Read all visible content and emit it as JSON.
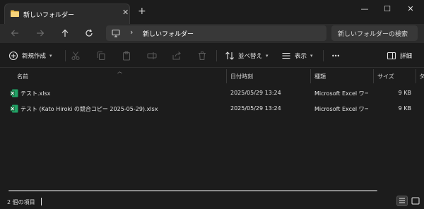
{
  "window": {
    "tab_title": "新しいフォルダー",
    "tab_close": "✕",
    "new_tab": "+",
    "minimize": "—",
    "maximize": "☐",
    "close": "✕"
  },
  "address": {
    "separator": "›",
    "path": "新しいフォルダー",
    "search_placeholder": "新しいフォルダーの検索"
  },
  "toolbar": {
    "new_label": "新規作成",
    "sort_label": "並べ替え",
    "view_label": "表示",
    "more_label": "•••",
    "details_label": "詳細"
  },
  "columns": {
    "name": "名前",
    "date": "日付時刻",
    "type": "種類",
    "size": "サイズ",
    "extra": "タ"
  },
  "files": [
    {
      "name": "テスト.xlsx",
      "date": "2025/05/29 13:24",
      "type": "Microsoft Excel ワークシート",
      "size": "9 KB"
    },
    {
      "name": "テスト (Kato Hiroki の競合コピー 2025-05-29).xlsx",
      "date": "2025/05/29 13:24",
      "type": "Microsoft Excel ワークシート",
      "size": "9 KB"
    }
  ],
  "status": {
    "item_count": "2 個の項目"
  },
  "colors": {
    "background": "#1c1c1c",
    "bar": "#2b2b2b",
    "folder_yellow": "#f2c14e",
    "excel_green": "#1e7145"
  }
}
